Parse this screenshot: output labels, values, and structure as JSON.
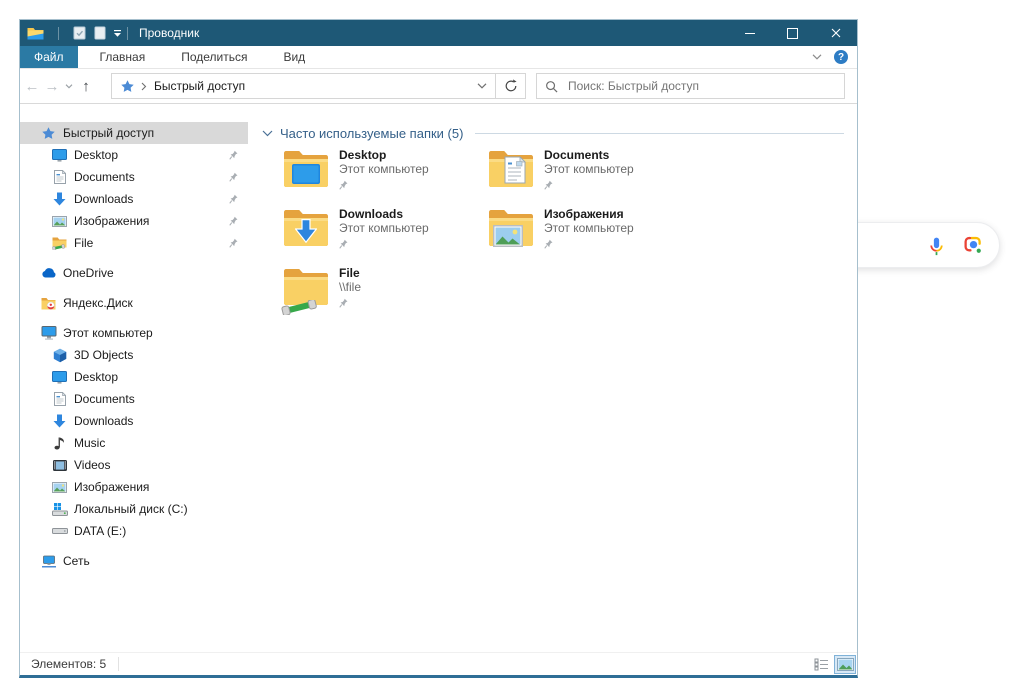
{
  "colors": {
    "titlebar": "#1E5876",
    "file_tab": "#2B7AA4",
    "window_border": "#A6BFCD",
    "window_bottom_border": "#2E6E96",
    "sidebar_selection": "#D9D9D9",
    "group_header_text": "#356089",
    "help_blue": "#2D7CC4",
    "folder_yellow": "#F9D064",
    "google_blue": "#4285F4",
    "google_red": "#EA4335",
    "google_yellow": "#FBBC05",
    "google_green": "#34A853"
  },
  "window": {
    "title": "Проводник",
    "qat_icons": [
      "explorer-logo-icon",
      "properties-icon",
      "new-item-icon",
      "qat-dropdown-icon"
    ],
    "caption_buttons": [
      "minimize",
      "maximize",
      "close"
    ]
  },
  "ribbon": {
    "tabs": [
      {
        "label": "Файл",
        "active": true
      },
      {
        "label": "Главная",
        "active": false
      },
      {
        "label": "Поделиться",
        "active": false
      },
      {
        "label": "Вид",
        "active": false
      }
    ],
    "right_icons": [
      "ribbon-collapse-icon",
      "help-icon"
    ]
  },
  "navbar": {
    "address": {
      "icon": "quick-access-star",
      "value": "Быстрый доступ"
    },
    "search": {
      "placeholder": "Поиск: Быстрый доступ"
    }
  },
  "sidebar": {
    "items": [
      {
        "label": "Быстрый доступ",
        "icon": "quick-access-star",
        "level": 0,
        "selected": true
      },
      {
        "label": "Desktop",
        "icon": "desktop",
        "level": 1,
        "pinned": true
      },
      {
        "label": "Documents",
        "icon": "document",
        "level": 1,
        "pinned": true
      },
      {
        "label": "Downloads",
        "icon": "download-arrow",
        "level": 1,
        "pinned": true
      },
      {
        "label": "Изображения",
        "icon": "pictures",
        "level": 1,
        "pinned": true
      },
      {
        "label": "File",
        "icon": "shared-folder",
        "level": 1,
        "pinned": true
      },
      {
        "label": "OneDrive",
        "icon": "onedrive-cloud",
        "level": 0,
        "gap_before": true
      },
      {
        "label": "Яндекс.Диск",
        "icon": "yandex-disk",
        "level": 0,
        "gap_before": true
      },
      {
        "label": "Этот компьютер",
        "icon": "this-pc",
        "level": 0,
        "gap_before": true
      },
      {
        "label": "3D Objects",
        "icon": "cube-3d",
        "level": 1
      },
      {
        "label": "Desktop",
        "icon": "desktop",
        "level": 1
      },
      {
        "label": "Documents",
        "icon": "document",
        "level": 1
      },
      {
        "label": "Downloads",
        "icon": "download-arrow",
        "level": 1
      },
      {
        "label": "Music",
        "icon": "music-note",
        "level": 1
      },
      {
        "label": "Videos",
        "icon": "film",
        "level": 1
      },
      {
        "label": "Изображения",
        "icon": "pictures",
        "level": 1
      },
      {
        "label": "Локальный диск (C:)",
        "icon": "drive-windows",
        "level": 1
      },
      {
        "label": "DATA (E:)",
        "icon": "drive",
        "level": 1
      },
      {
        "label": "Сеть",
        "icon": "network-pc",
        "level": 0,
        "gap_before": true
      }
    ]
  },
  "main": {
    "group_title": "Часто используемые папки (5)",
    "tiles": [
      {
        "name": "Desktop",
        "location": "Этот компьютер",
        "icon": "folder-desktop",
        "pinned": true
      },
      {
        "name": "Documents",
        "location": "Этот компьютер",
        "icon": "folder-documents",
        "pinned": true
      },
      {
        "name": "Downloads",
        "location": "Этот компьютер",
        "icon": "folder-downloads",
        "pinned": true
      },
      {
        "name": "Изображения",
        "location": "Этот компьютер",
        "icon": "folder-pictures",
        "pinned": true
      },
      {
        "name": "File",
        "location": "\\\\file",
        "icon": "folder-network",
        "pinned": true
      }
    ]
  },
  "statusbar": {
    "items_label": "Элементов: 5",
    "view_buttons": [
      {
        "icon": "view-details",
        "selected": false
      },
      {
        "icon": "view-thumbnails",
        "selected": true
      }
    ]
  },
  "google_bar": {
    "icons": [
      "mic-icon",
      "lens-icon"
    ]
  }
}
